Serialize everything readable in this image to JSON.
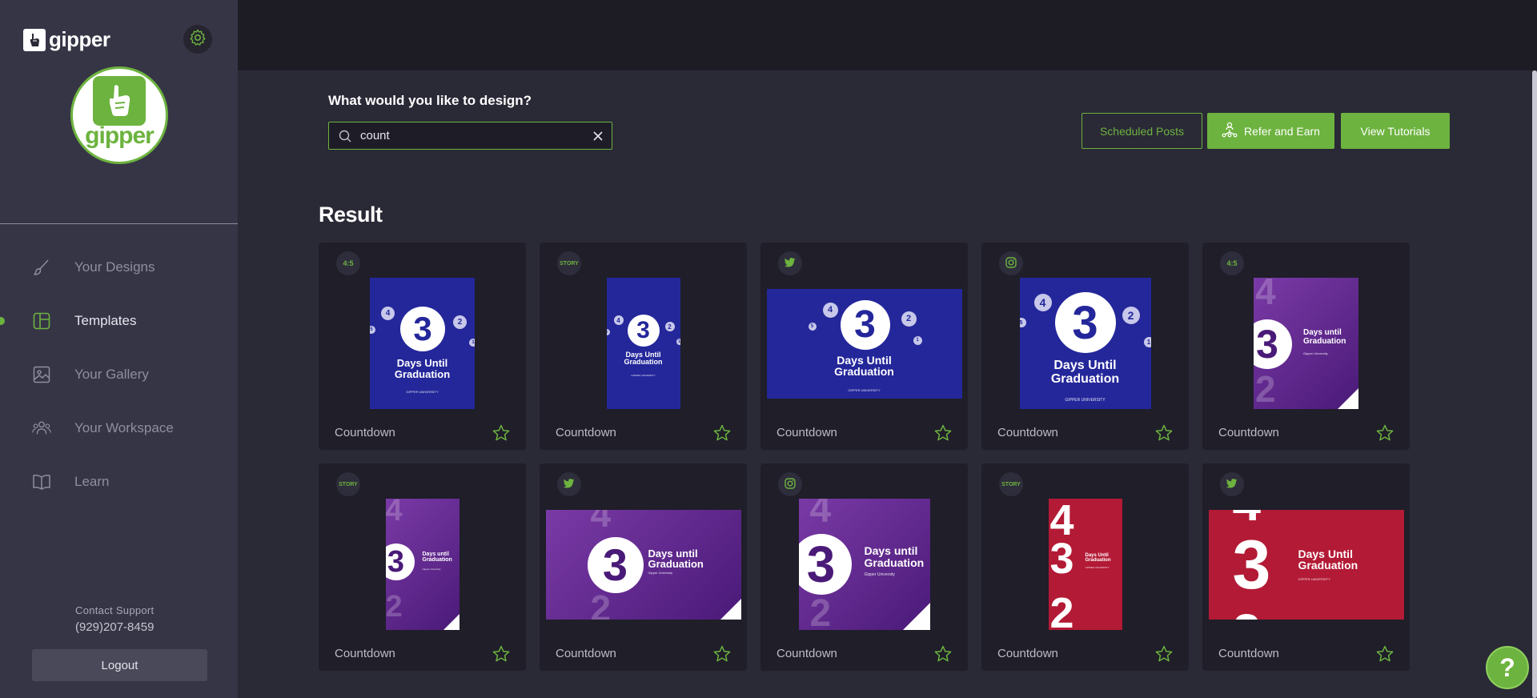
{
  "brand": {
    "name": "gipper",
    "accent": "#6db33f",
    "avatar_text": "gipper"
  },
  "sidebar": {
    "items": [
      {
        "label": "Your Designs",
        "icon": "brush-icon",
        "active": false
      },
      {
        "label": "Templates",
        "icon": "layout-icon",
        "active": true
      },
      {
        "label": "Your Gallery",
        "icon": "image-icon",
        "active": false
      },
      {
        "label": "Your Workspace",
        "icon": "users-icon",
        "active": false
      },
      {
        "label": "Learn",
        "icon": "book-icon",
        "active": false
      }
    ],
    "support_title": "Contact Support",
    "support_phone": "(929)207-8459",
    "logout_label": "Logout"
  },
  "main": {
    "question": "What would you like to design?",
    "search": {
      "value": "count"
    },
    "buttons": {
      "scheduled": "Scheduled Posts",
      "refer": "Refer and Earn",
      "tutorials": "View Tutorials"
    },
    "result_title": "Result"
  },
  "cards": [
    {
      "badge": "4:5",
      "label": "Countdown",
      "style": "blue",
      "format": "portrait45",
      "headline": "Days Until Graduation",
      "sub": "GIPPER UNIVERSITY",
      "big": "3"
    },
    {
      "badge": "STORY",
      "label": "Countdown",
      "style": "blue",
      "format": "story",
      "headline": "Days Until Graduation",
      "sub": "GIPPER UNIVERSITY",
      "big": "3"
    },
    {
      "badge": "twitter-icon",
      "label": "Countdown",
      "style": "blue",
      "format": "wide",
      "headline": "Days Until Graduation",
      "sub": "GIPPER UNIVERSITY",
      "big": "3"
    },
    {
      "badge": "instagram-icon",
      "label": "Countdown",
      "style": "blue",
      "format": "square",
      "headline": "Days Until Graduation",
      "sub": "GIPPER UNIVERSITY",
      "big": "3"
    },
    {
      "badge": "4:5",
      "label": "Countdown",
      "style": "purple",
      "format": "portrait45",
      "headline": "Days until Graduation",
      "sub": "Gipper University",
      "big": "3"
    },
    {
      "badge": "STORY",
      "label": "Countdown",
      "style": "purple",
      "format": "story",
      "headline": "Days until Graduation",
      "sub": "Gipper University",
      "big": "3"
    },
    {
      "badge": "twitter-icon",
      "label": "Countdown",
      "style": "purple",
      "format": "wide",
      "headline": "Days until Graduation",
      "sub": "Gipper University",
      "big": "3"
    },
    {
      "badge": "instagram-icon",
      "label": "Countdown",
      "style": "purple",
      "format": "square",
      "headline": "Days until Graduation",
      "sub": "Gipper University",
      "big": "3"
    },
    {
      "badge": "STORY",
      "label": "Countdown",
      "style": "red",
      "format": "story",
      "headline": "Days Until Graduation",
      "sub": "GIPPER UNIVERSITY",
      "big": "3"
    },
    {
      "badge": "twitter-icon",
      "label": "Countdown",
      "style": "red",
      "format": "wide",
      "headline": "Days Until Graduation",
      "sub": "GIPPER UNIVERSITY",
      "big": "3"
    }
  ],
  "help_glyph": "?"
}
